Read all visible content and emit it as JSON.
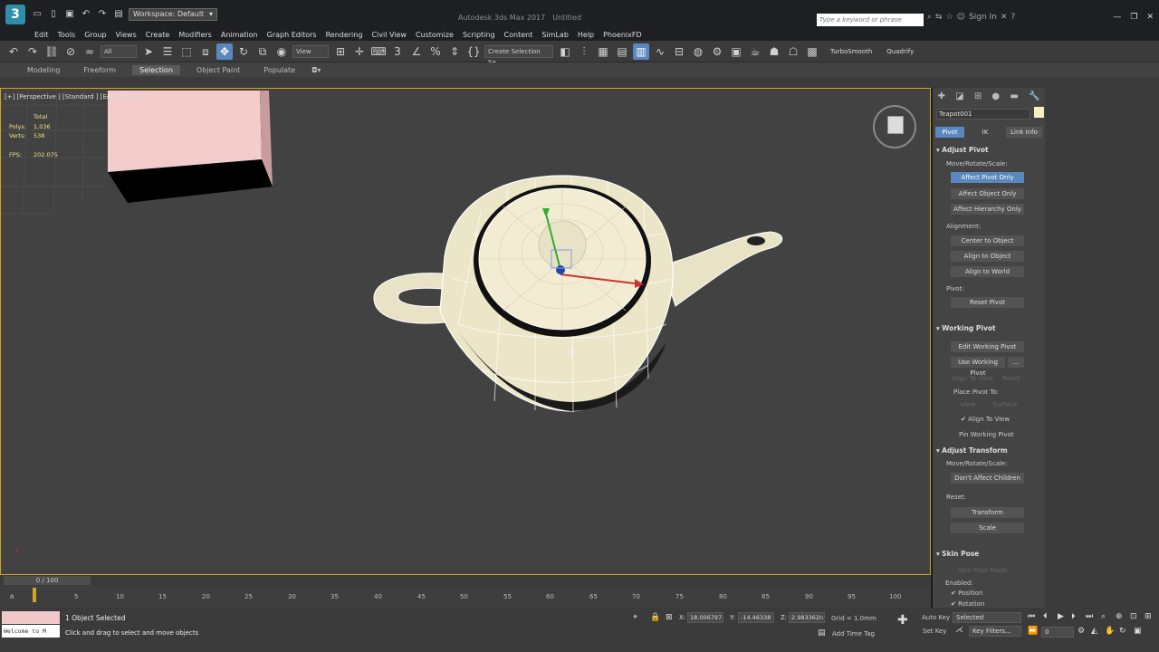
{
  "titlebar": {
    "app_letter": "3",
    "workspace": "Workspace: Default",
    "title": "Autodesk 3ds Max 2017",
    "file": "Untitled",
    "search_placeholder": "Type a keyword or phrase",
    "sign_in": "Sign In"
  },
  "menu": [
    "Edit",
    "Tools",
    "Group",
    "Views",
    "Create",
    "Modifiers",
    "Animation",
    "Graph Editors",
    "Rendering",
    "Civil View",
    "Customize",
    "Scripting",
    "Content",
    "SimLab",
    "Help",
    "PhoenixFD"
  ],
  "toolbar": {
    "filter": "All",
    "view_ref": "View",
    "selection_set": "Create Selection Se",
    "turbosmooth": "TurboSmooth",
    "quadrify": "Quadrify"
  },
  "ribbon": {
    "tabs": [
      "Modeling",
      "Freeform",
      "Selection",
      "Object Paint",
      "Populate"
    ],
    "active": "Selection"
  },
  "viewport": {
    "label": "[+] [Perspective ] [Standard ] [Edged Faces ]",
    "stats": {
      "header": "Total",
      "polys_label": "Polys:",
      "polys": "1,036",
      "verts_label": "Verts:",
      "verts": "538",
      "fps_label": "FPS:",
      "fps": "202.075"
    }
  },
  "command_panel": {
    "object_name": "Teapot001",
    "object_color": "#f4eec0",
    "tabs": [
      "Pivot",
      "IK",
      "Link Info"
    ],
    "active_tab": "Pivot",
    "adjust_pivot": {
      "title": "Adjust Pivot",
      "move_label": "Move/Rotate/Scale:",
      "affect_pivot": "Affect Pivot Only",
      "affect_object": "Affect Object Only",
      "affect_hierarchy": "Affect Hierarchy Only",
      "alignment_label": "Alignment:",
      "center": "Center to Object",
      "align_object": "Align to Object",
      "align_world": "Align to World",
      "pivot_label": "Pivot:",
      "reset_pivot": "Reset Pivot"
    },
    "working_pivot": {
      "title": "Working Pivot",
      "edit": "Edit Working Pivot",
      "use": "Use Working Pivot",
      "use_dots": "...",
      "align_view": "Align To View",
      "reset": "Reset",
      "place_label": "Place Pivot To:",
      "view": "View",
      "surface": "Surface",
      "align_to_view": "Align To View",
      "pin": "Pin Working Pivot"
    },
    "adjust_transform": {
      "title": "Adjust Transform",
      "move_label": "Move/Rotate/Scale:",
      "dont_affect": "Don't Affect Children",
      "reset_label": "Reset:",
      "transform": "Transform",
      "scale": "Scale"
    },
    "skin_pose": {
      "title": "Skin Pose",
      "mode": "Skin Pose Mode",
      "enabled_label": "Enabled:",
      "position": "Position",
      "rotation": "Rotation"
    }
  },
  "timeline": {
    "frame": "0 / 100",
    "ticks": [
      "5",
      "10",
      "15",
      "20",
      "25",
      "30",
      "35",
      "40",
      "45",
      "50",
      "55",
      "60",
      "65",
      "70",
      "75",
      "80",
      "85",
      "90",
      "95",
      "100"
    ]
  },
  "status": {
    "maxscript": "Welcome to M",
    "selected": "1 Object Selected",
    "prompt": "Click and drag to select and move objects",
    "x_label": "X:",
    "x": "18.006797",
    "y_label": "Y:",
    "y": "-14.46338",
    "z_label": "Z:",
    "z": "2.983362n",
    "grid": "Grid = 1.0mm",
    "add_time_tag": "Add Time Tag",
    "auto_key": "Auto Key",
    "set_key": "Set Key",
    "selected_dd": "Selected",
    "key_filters": "Key Filters...",
    "frame_field": "0"
  }
}
